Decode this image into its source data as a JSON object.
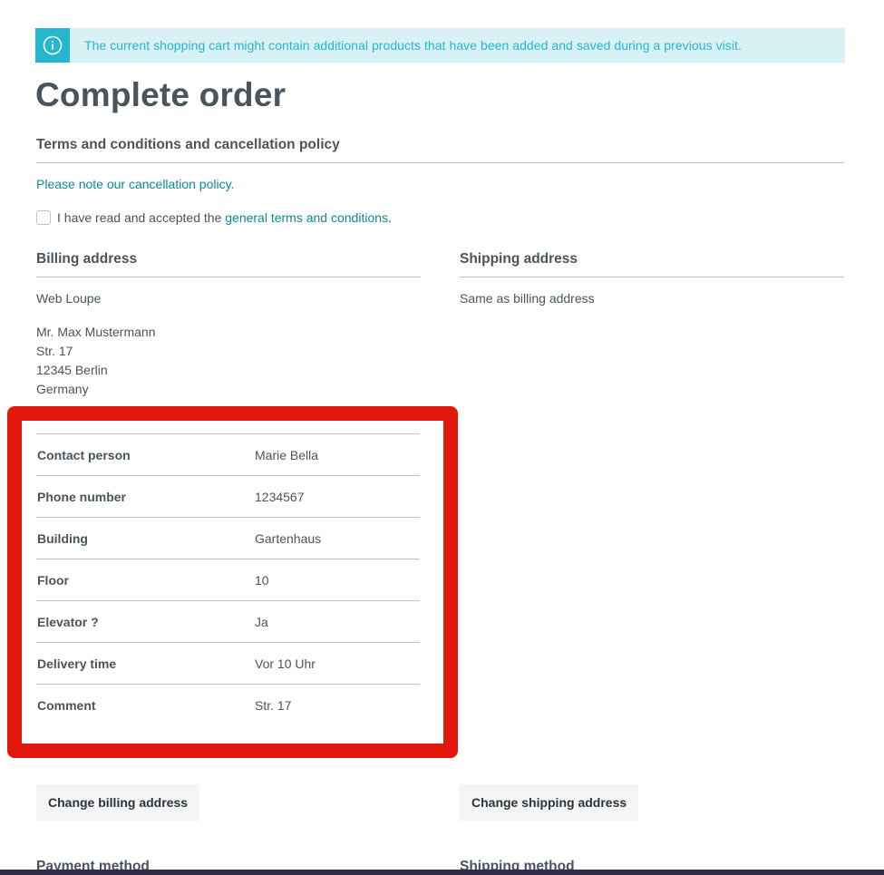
{
  "banner": {
    "icon": "info-icon",
    "text": "The current shopping cart might contain additional products that have been added and saved during a previous visit."
  },
  "page_title": "Complete order",
  "terms": {
    "heading": "Terms and conditions and cancellation policy",
    "cancellation_link": "Please note our cancellation policy.",
    "checkbox_checked": false,
    "checkbox_label_prefix": "I have read and accepted the",
    "checkbox_link": "general terms and conditions",
    "checkbox_label_suffix": "."
  },
  "billing": {
    "heading": "Billing address",
    "company": "Web Loupe",
    "lines": [
      "Mr. Max Mustermann",
      "Str. 17",
      "12345 Berlin",
      "Germany"
    ],
    "details": [
      {
        "label": "Contact person",
        "value": "Marie Bella"
      },
      {
        "label": "Phone number",
        "value": "1234567"
      },
      {
        "label": "Building",
        "value": "Gartenhaus"
      },
      {
        "label": "Floor",
        "value": "10"
      },
      {
        "label": "Elevator ?",
        "value": "Ja"
      },
      {
        "label": "Delivery time",
        "value": "Vor 10 Uhr"
      },
      {
        "label": "Comment",
        "value": "Str. 17"
      }
    ],
    "change_button": "Change billing address"
  },
  "shipping": {
    "heading": "Shipping address",
    "text": "Same as billing address",
    "change_button": "Change shipping address"
  },
  "next_sections": {
    "payment_heading": "Payment method",
    "shipping_method_heading": "Shipping method"
  },
  "colors": {
    "accent": "#26b6cf",
    "link": "#0b8a8f",
    "highlight": "#e2180c",
    "text": "#4a545b"
  }
}
